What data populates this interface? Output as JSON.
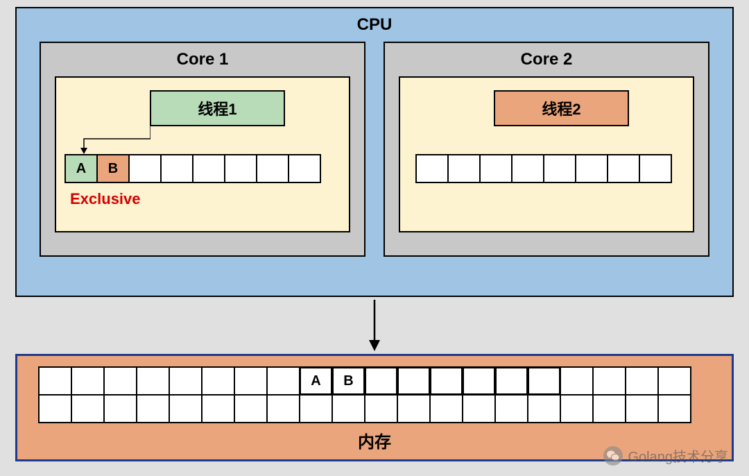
{
  "cpu": {
    "title": "CPU",
    "cores": [
      {
        "title": "Core 1",
        "thread_label": "线程1",
        "state_label": "Exclusive",
        "cache": [
          "A",
          "B",
          "",
          "",
          "",
          "",
          "",
          ""
        ]
      },
      {
        "title": "Core 2",
        "thread_label": "线程2",
        "cache": [
          "",
          "",
          "",
          "",
          "",
          "",
          "",
          ""
        ]
      }
    ]
  },
  "memory": {
    "label": "内存",
    "row1": [
      "",
      "",
      "",
      "",
      "",
      "",
      "",
      "",
      "A",
      "B",
      "",
      "",
      "",
      "",
      "",
      "",
      "",
      "",
      "",
      ""
    ],
    "row2": [
      "",
      "",
      "",
      "",
      "",
      "",
      "",
      "",
      "",
      "",
      "",
      "",
      "",
      "",
      "",
      "",
      "",
      "",
      "",
      ""
    ],
    "a_index": 8,
    "b_index": 9
  },
  "watermark": {
    "text": "Golang技术分享"
  }
}
